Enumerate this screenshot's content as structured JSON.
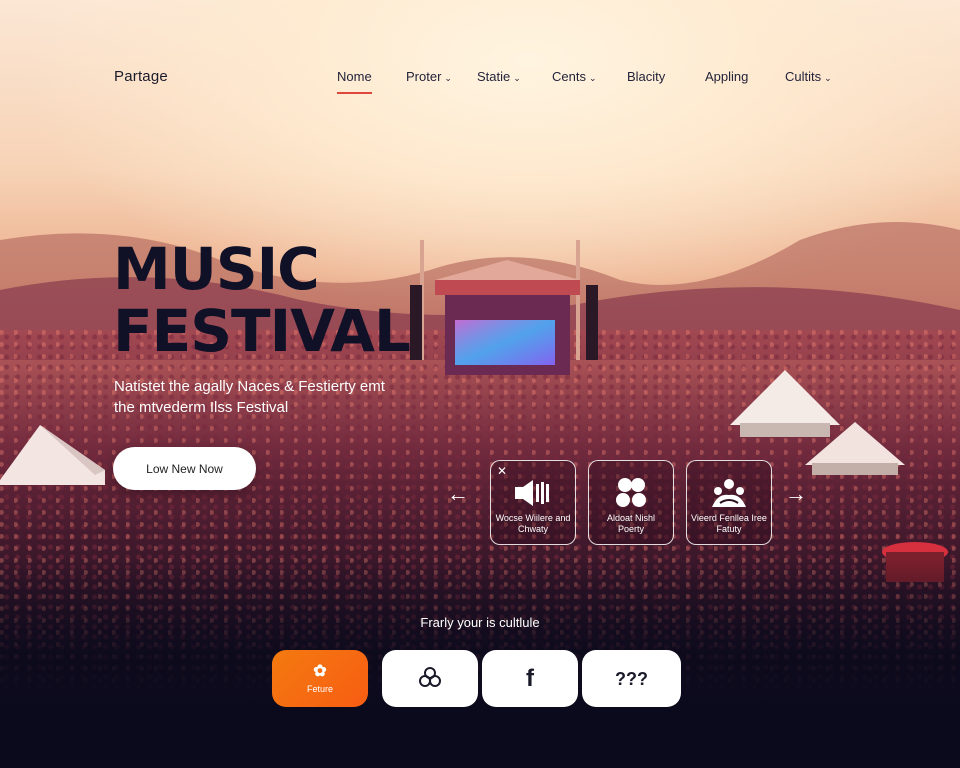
{
  "brand": {
    "logo": "Partage"
  },
  "nav": {
    "items": [
      {
        "label": "Nome",
        "active": true,
        "dropdown": false
      },
      {
        "label": "Proter",
        "active": false,
        "dropdown": true
      },
      {
        "label": "Statie",
        "active": false,
        "dropdown": true
      },
      {
        "label": "Cents",
        "active": false,
        "dropdown": true
      },
      {
        "label": "Blacity",
        "active": false,
        "dropdown": false
      },
      {
        "label": "Appling",
        "active": false,
        "dropdown": false
      },
      {
        "label": "Cultits",
        "active": false,
        "dropdown": true
      }
    ]
  },
  "hero": {
    "title_line1": "MUSIC",
    "title_line2": "FESTIVAL",
    "subtitle": "Natistet the agally Naces & Festierty emt the mtvederm Ilss Festival",
    "cta_label": "Low New Now"
  },
  "features": {
    "cards": [
      {
        "label": "Wocse Wiilere and Chwaty",
        "icon": "speaker-icon",
        "has_close": true
      },
      {
        "label": "Aldoat Nishl Poerty",
        "icon": "people-group-icon",
        "has_close": false
      },
      {
        "label": "Vieerd Fenllea Iree Fatuty",
        "icon": "community-icon",
        "has_close": false
      }
    ]
  },
  "footer": {
    "follow_text": "Frarly your is cultlule",
    "social": [
      {
        "label": "Feture",
        "icon": "flower-icon",
        "glyph": "✿"
      },
      {
        "label": "",
        "icon": "link-knot-icon",
        "glyph": ""
      },
      {
        "label": "",
        "icon": "facebook-icon",
        "glyph": "f"
      },
      {
        "label": "",
        "icon": "more-icon",
        "glyph": "???"
      }
    ]
  },
  "colors": {
    "accent": "#f47a10",
    "active_underline": "#e0473c",
    "title": "#101027",
    "dark_bg": "#0b0a1c"
  }
}
